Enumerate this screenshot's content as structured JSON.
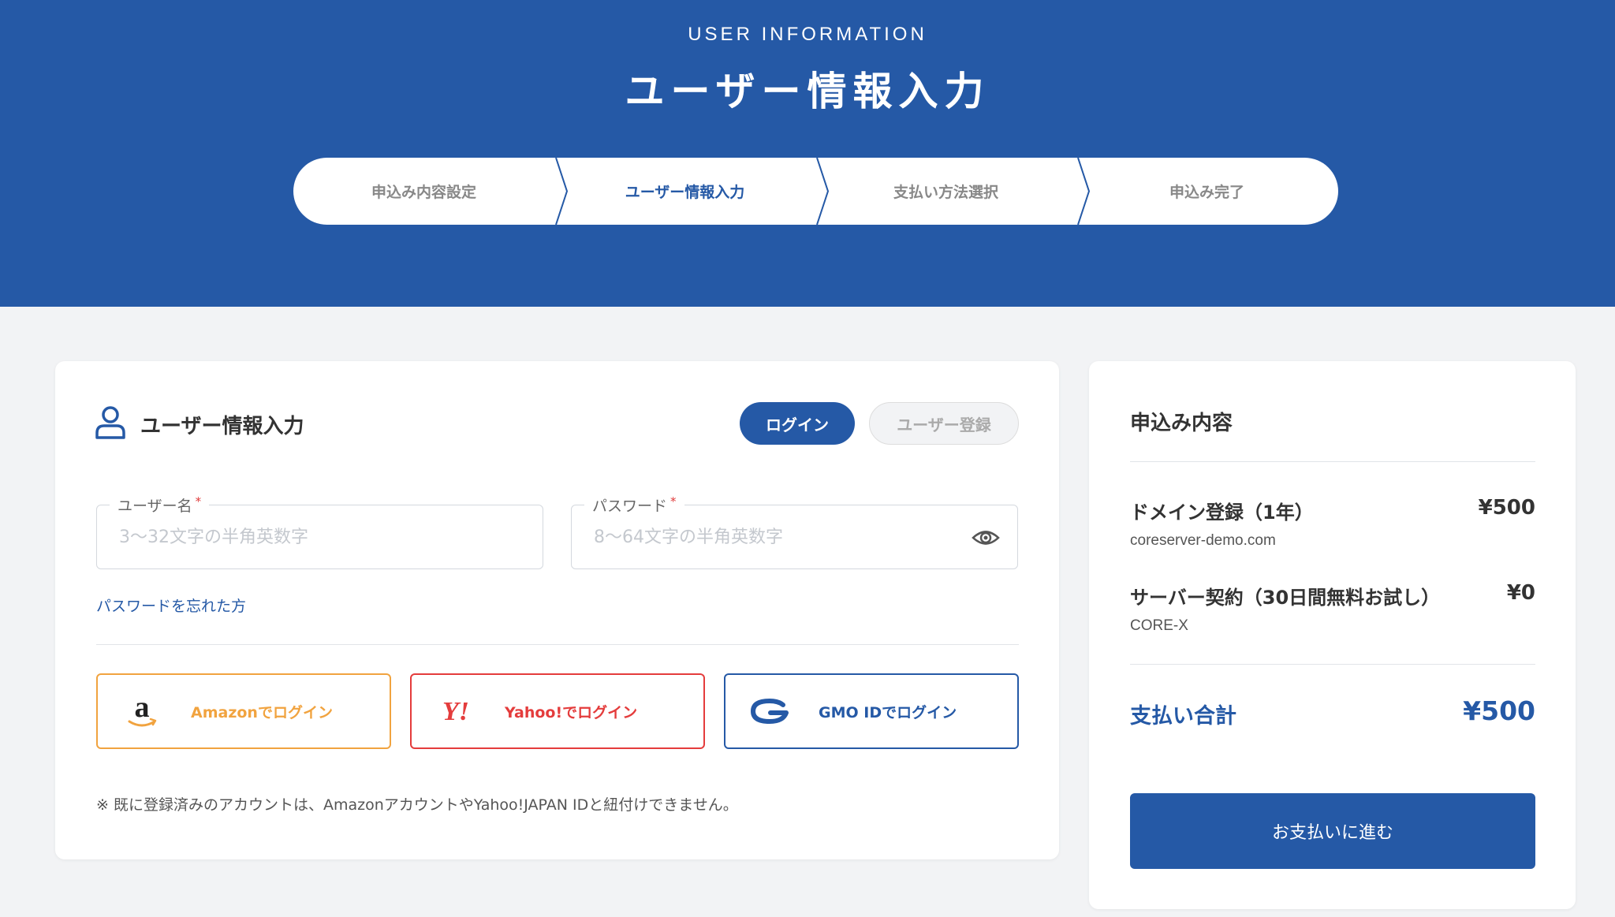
{
  "hero": {
    "eyebrow": "USER INFORMATION",
    "title": "ユーザー情報入力",
    "background_color": "#2559a6"
  },
  "steps": [
    {
      "label": "申込み内容設定",
      "active": false
    },
    {
      "label": "ユーザー情報入力",
      "active": true
    },
    {
      "label": "支払い方法選択",
      "active": false
    },
    {
      "label": "申込み完了",
      "active": false
    }
  ],
  "main": {
    "title": "ユーザー情報入力",
    "title_icon": "user-icon",
    "tabs": {
      "login": "ログイン",
      "register": "ユーザー登録"
    },
    "username": {
      "label": "ユーザー名",
      "required_mark": "*",
      "placeholder": "3〜32文字の半角英数字",
      "value": ""
    },
    "password": {
      "label": "パスワード",
      "required_mark": "*",
      "placeholder": "8〜64文字の半角英数字",
      "value": "",
      "toggle_icon": "eye-icon"
    },
    "forgot_link": "パスワードを忘れた方",
    "social": {
      "amazon": {
        "label": "Amazonでログイン",
        "icon": "amazon-logo-icon",
        "color": "#f1a33f"
      },
      "yahoo": {
        "label": "Yahoo!でログイン",
        "icon": "yahoo-logo-icon",
        "color": "#e43c3c"
      },
      "gmo": {
        "label": "GMO IDでログイン",
        "icon": "gmo-logo-icon",
        "color": "#2559a6"
      }
    },
    "note": "※ 既に登録済みのアカウントは、AmazonアカウントやYahoo!JAPAN IDと紐付けできません。"
  },
  "summary": {
    "title": "申込み内容",
    "items": [
      {
        "name": "ドメイン登録（1年）",
        "price": "¥500",
        "sub": "coreserver-demo.com"
      },
      {
        "name": "サーバー契約（30日間無料お試し）",
        "price": "¥0",
        "sub": "CORE-X"
      }
    ],
    "total_label": "支払い合計",
    "total_value": "¥500",
    "pay_button": "お支払いに進む"
  }
}
